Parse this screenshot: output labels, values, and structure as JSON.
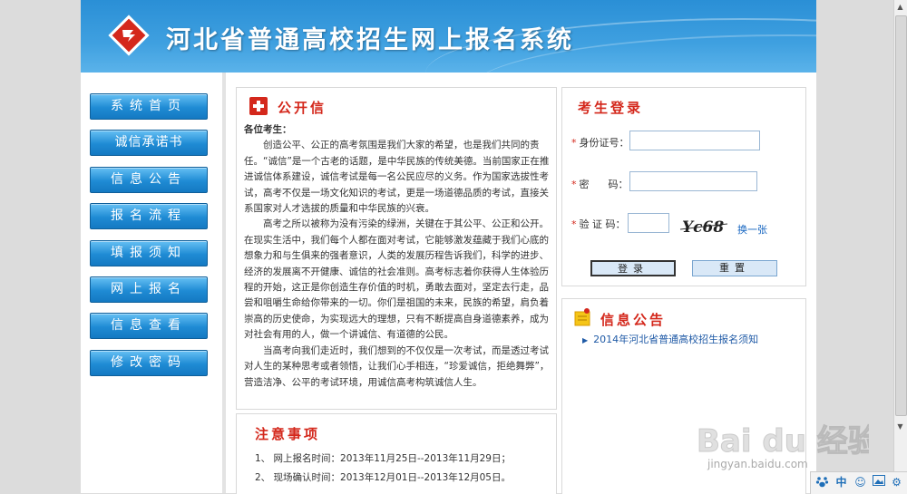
{
  "header": {
    "title": "河北省普通高校招生网上报名系统"
  },
  "nav": {
    "items": [
      "系统首页",
      "诚信承诺书",
      "信息公告",
      "报名流程",
      "填报须知",
      "网上报名",
      "信息查看",
      "修改密码"
    ]
  },
  "letter": {
    "title": "公开信",
    "greeting": "各位考生：",
    "paragraphs": [
      "创造公平、公正的高考氛围是我们大家的希望，也是我们共同的责任。“诚信”是一个古老的话题，是中华民族的传统美德。当前国家正在推进诚信体系建设，诚信考试是每一名公民应尽的义务。作为国家选拔性考试，高考不仅是一场文化知识的考试，更是一场道德品质的考试，直接关系国家对人才选拔的质量和中华民族的兴衰。",
      "高考之所以被称为没有污染的绿洲，关键在于其公平、公正和公开。在现实生活中，我们每个人都在面对考试，它能够激发蕴藏于我们心底的想象力和与生俱来的强者意识，人类的发展历程告诉我们，科学的进步、经济的发展离不开健康、诚信的社会准则。高考标志着你获得人生体验历程的开始，这正是你创造生存价值的时机，勇敢去面对，坚定去行走，品尝和咀嚼生命给你带来的一切。你们是祖国的未来，民族的希望，肩负着崇高的历史使命，为实现远大的理想，只有不断提高自身道德素养，成为对社会有用的人，做一个讲诚信、有道德的公民。",
      "当高考向我们走近时，我们想到的不仅仅是一次考试，而是透过考试对人生的某种思考或者领悟，让我们心手相连，“珍爱诚信，拒绝舞弊”，营造洁净、公平的考试环境，用诚信高考构筑诚信人生。"
    ]
  },
  "notice": {
    "title": "注意事项",
    "items": [
      "1、 网上报名时间：2013年11月25日--2013年11月29日；",
      "2、 现场确认时间：2013年12月01日--2013年12月05日。"
    ]
  },
  "login": {
    "title": "考生登录",
    "id_label": "身份证号：",
    "password_label": "密      码：",
    "captcha_label": "验 证 码：",
    "captcha_text": "Yc68",
    "refresh_label": "换一张",
    "login_button": "登录",
    "reset_button": "重置",
    "id_value": "",
    "password_value": "",
    "captcha_value": ""
  },
  "announcements": {
    "title": "信息公告",
    "items": [
      "2014年河北省普通高校招生报名须知"
    ]
  },
  "watermark": {
    "text": "jingyan.baidu.com",
    "brand": "Bai du 经验"
  },
  "tray": {
    "icons": [
      "paw-icon",
      "chinese-input-icon",
      "smile-icon",
      "image-icon",
      "gear-icon"
    ],
    "ime_label": "中"
  },
  "colors": {
    "banner": "#2a8fd6",
    "accent_red": "#d4281c",
    "nav_button": "#1f8bd4",
    "link_blue": "#1565c0"
  }
}
